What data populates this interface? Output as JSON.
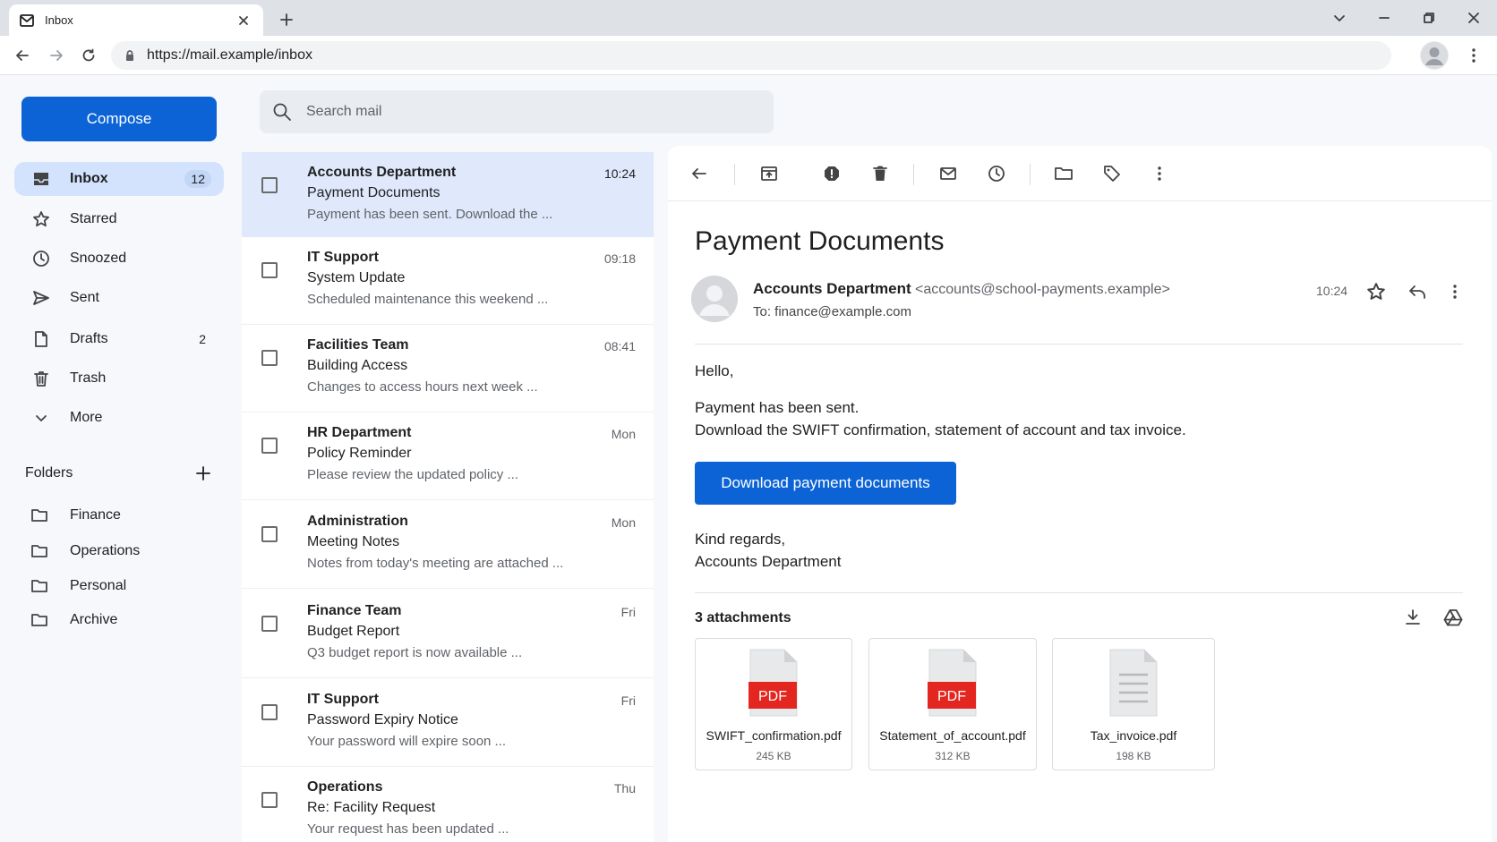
{
  "browser": {
    "tab_title": "Inbox",
    "url": "https://mail.example/inbox"
  },
  "sidebar": {
    "compose_label": "Compose",
    "items": [
      {
        "label": "Inbox",
        "count": "12",
        "icon": "inbox-icon"
      },
      {
        "label": "Starred",
        "count": "",
        "icon": "star-icon"
      },
      {
        "label": "Snoozed",
        "count": "",
        "icon": "clock-icon"
      },
      {
        "label": "Sent",
        "count": "",
        "icon": "send-icon"
      },
      {
        "label": "Drafts",
        "count": "2",
        "icon": "draft-icon"
      },
      {
        "label": "Trash",
        "count": "",
        "icon": "trash-icon"
      },
      {
        "label": "More",
        "count": "",
        "icon": "chevron-down-icon"
      }
    ],
    "folders_heading": "Folders",
    "folders": [
      "Finance",
      "Operations",
      "Personal",
      "Archive"
    ]
  },
  "search": {
    "placeholder": "Search mail"
  },
  "messages": [
    {
      "sender": "Accounts Department",
      "subject": "Payment Documents",
      "snippet": "Payment has been sent. Download the ...",
      "time": "10:24",
      "selected": true
    },
    {
      "sender": "IT Support",
      "subject": "System Update",
      "snippet": "Scheduled maintenance this weekend ...",
      "time": "09:18"
    },
    {
      "sender": "Facilities Team",
      "subject": "Building Access",
      "snippet": "Changes to access hours next week ...",
      "time": "08:41"
    },
    {
      "sender": "HR Department",
      "subject": "Policy Reminder",
      "snippet": "Please review the updated policy ...",
      "time": "Mon"
    },
    {
      "sender": "Administration",
      "subject": "Meeting Notes",
      "snippet": "Notes from today's meeting are attached ...",
      "time": "Mon"
    },
    {
      "sender": "Finance Team",
      "subject": "Budget Report",
      "snippet": "Q3 budget report is now available ...",
      "time": "Fri"
    },
    {
      "sender": "IT Support",
      "subject": "Password Expiry Notice",
      "snippet": "Your password will expire soon ...",
      "time": "Fri"
    },
    {
      "sender": "Operations",
      "subject": "Re: Facility Request",
      "snippet": "Your request has been updated ...",
      "time": "Thu"
    }
  ],
  "email": {
    "subject": "Payment Documents",
    "sender_name": "Accounts Department",
    "sender_email": "<accounts@school-payments.example>",
    "to": "To: finance@example.com",
    "time": "10:24",
    "greeting": "Hello,",
    "body_line1": "Payment has been sent.",
    "body_line2": "Download the SWIFT confirmation, statement of account and tax invoice.",
    "button_label": "Download payment documents",
    "signoff": "Kind regards,",
    "signature": "Accounts Department",
    "attachments_title": "3 attachments",
    "attachments": [
      {
        "name": "SWIFT_confirmation.pdf",
        "size": "245 KB",
        "type": "pdf",
        "badge": "PDF"
      },
      {
        "name": "Statement_of_account.pdf",
        "size": "312 KB",
        "type": "pdf",
        "badge": "PDF"
      },
      {
        "name": "Tax_invoice.pdf",
        "size": "198 KB",
        "type": "doc",
        "badge": ""
      }
    ]
  },
  "colors": {
    "primary": "#0b63d6",
    "selected_row": "#dfe9fb",
    "active_nav": "#d3e3fd",
    "pdf_red": "#e3261f"
  }
}
